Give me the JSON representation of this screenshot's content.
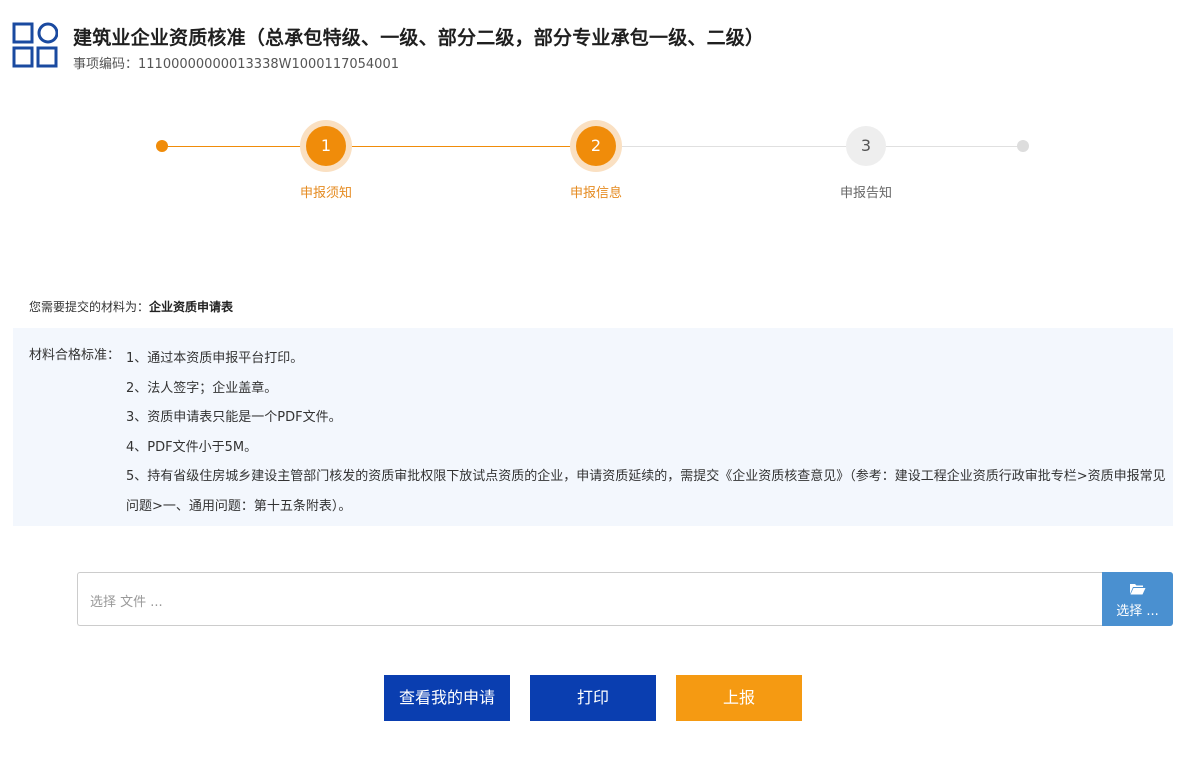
{
  "header": {
    "title": "建筑业企业资质核准（总承包特级、一级、部分二级，部分专业承包一级、二级）",
    "code_label": "事项编码：",
    "code_value": "11100000000013338W1000117054001",
    "logo_icon": "grid-logo-icon",
    "brand_color": "#1a4aa0"
  },
  "steps": [
    {
      "number": "1",
      "label": "申报须知",
      "status": "active"
    },
    {
      "number": "2",
      "label": "申报信息",
      "status": "active"
    },
    {
      "number": "3",
      "label": "申报告知",
      "status": "pending"
    }
  ],
  "materials": {
    "prefix": "您需要提交的材料为：",
    "name": "企业资质申请表"
  },
  "standards": {
    "label": "材料合格标准：",
    "items": [
      "1、通过本资质申报平台打印。",
      "2、法人签字；企业盖章。",
      "3、资质申请表只能是一个PDF文件。",
      "4、PDF文件小于5M。",
      "5、持有省级住房城乡建设主管部门核发的资质审批权限下放试点资质的企业，申请资质延续的，需提交《企业资质核查意见》（参考：建设工程企业资质行政审批专栏>资质申报常见问题>一、通用问题：第十五条附表）。"
    ]
  },
  "upload": {
    "placeholder": "选择 文件 ...",
    "button_label": "选择 ...",
    "button_icon": "folder-open-icon"
  },
  "buttons": {
    "view": "查看我的申请",
    "print": "打印",
    "submit": "上报"
  },
  "colors": {
    "accent_orange": "#f08c0a",
    "primary_blue": "#0a3eb0",
    "upload_blue": "#4a90d0",
    "standards_bg": "#f3f7fd"
  }
}
